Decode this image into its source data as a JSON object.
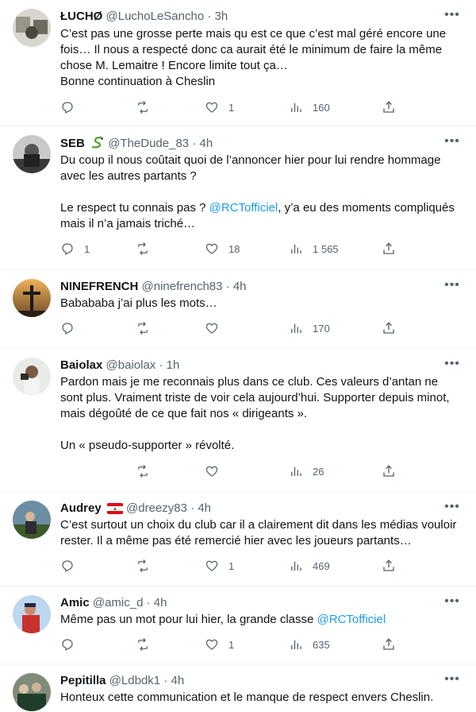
{
  "tweets": [
    {
      "name": "ŁUCHØ",
      "handle": "@LuchoLeSancho",
      "time": "3h",
      "text": "C’est pas une grosse perte mais qu est ce que c’est mal géré encore une fois… Il nous a respecté donc ca aurait été le minimum de faire la même chose M. Lemaitre ! Encore limite tout ça…\nBonne continuation à Cheslin",
      "replies": "",
      "retweets": "",
      "likes": "1",
      "views": "160"
    },
    {
      "name": "SEB",
      "handle": "@TheDude_83",
      "time": "4h",
      "text_pre": "Du coup il nous coûtait quoi de l’annoncer hier pour lui rendre hommage avec les autres partants ?\n\nLe respect tu connais pas ? ",
      "mention": "@RCTofficiel",
      "text_post": ", y’a eu des moments compliqués mais il n’a jamais triché…",
      "replies": "1",
      "retweets": "",
      "likes": "18",
      "views": "1 565"
    },
    {
      "name": "NINEFRENCH",
      "handle": "@ninefrench83",
      "time": "4h",
      "text": "Babababa j’ai plus les mots…",
      "replies": "",
      "retweets": "",
      "likes": "",
      "views": "170"
    },
    {
      "name": "Baiolax",
      "handle": "@baiolax",
      "time": "1h",
      "text": "Pardon mais je me reconnais plus dans ce club. Ces valeurs d’antan ne sont plus. Vraiment triste de voir cela aujourd’hui. Supporter depuis minot, mais dégoûté de ce que fait nos « dirigeants ».\n\nUn « pseudo-supporter » révolté.",
      "replies": "",
      "retweets": "",
      "likes": "",
      "views": "26"
    },
    {
      "name": "Audrey",
      "handle": "@dreezy83",
      "time": "4h",
      "text": "C’est surtout un choix du club car il a clairement dit dans les médias vouloir rester. Il a même pas été remercié hier avec les joueurs partants…",
      "replies": "",
      "retweets": "",
      "likes": "1",
      "views": "469"
    },
    {
      "name": "Amic",
      "handle": "@amic_d",
      "time": "4h",
      "text_pre": "Même pas un mot pour lui hier, la grande classe ",
      "mention": "@RCTofficiel",
      "replies": "",
      "retweets": "",
      "likes": "1",
      "views": "635"
    },
    {
      "name": "Pepitilla",
      "handle": "@Ldbdk1",
      "time": "4h",
      "text": "Honteux cette communication et le manque de respect envers Cheslin."
    }
  ],
  "colors": {
    "accent": "#1d9bf0",
    "muted": "#536471",
    "text": "#0f1419",
    "divider": "#eff3f4"
  },
  "icons": [
    "reply-icon",
    "retweet-icon",
    "like-icon",
    "views-icon",
    "share-icon",
    "more-icon"
  ]
}
